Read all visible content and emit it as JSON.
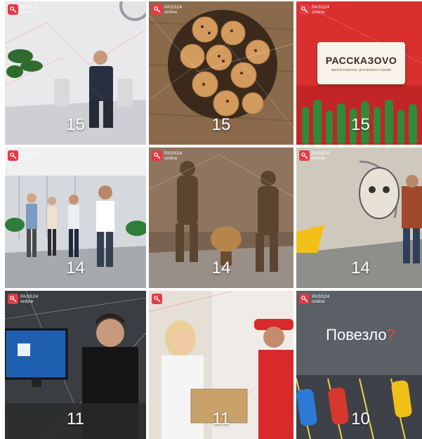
{
  "brand": {
    "line1": "PASS24",
    "line2": "online"
  },
  "tiles": [
    {
      "count": "15",
      "icon": "office-worker-photo"
    },
    {
      "count": "15",
      "icon": "cookies-photo"
    },
    {
      "count": "15",
      "icon": "rasskazovo-poster",
      "brand_name": "РАССКАЗОVO",
      "brand_tagline": "жилой комплекс для жизни в отрыве"
    },
    {
      "count": "14",
      "icon": "office-walkers-photo"
    },
    {
      "count": "14",
      "icon": "statues-photo"
    },
    {
      "count": "14",
      "icon": "graffiti-photo"
    },
    {
      "count": "11",
      "icon": "computer-user-photo"
    },
    {
      "count": "11",
      "icon": "courier-delivery-photo"
    },
    {
      "count": "10",
      "icon": "parking-poster",
      "title": "Повезло",
      "title_mark": "?"
    }
  ],
  "colors": {
    "brand_red": "#e63946",
    "accent_red": "#e94a3f"
  }
}
